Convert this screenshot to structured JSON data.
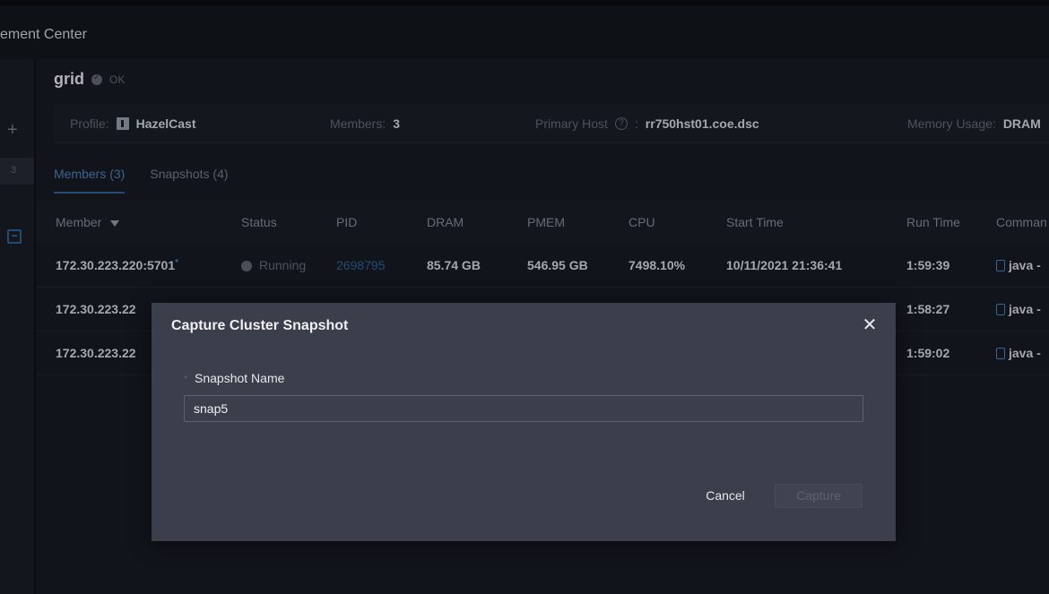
{
  "app": {
    "title": "ement Center"
  },
  "sidebar": {
    "active_item_label": "3"
  },
  "cluster": {
    "name": "grid",
    "status": "OK"
  },
  "infobar": {
    "profile_label": "Profile:",
    "profile_value": "HazelCast",
    "members_label": "Members:",
    "members_value": "3",
    "primary_host_label": "Primary Host",
    "primary_host_suffix": ":",
    "primary_host_value": "rr750hst01.coe.dsc",
    "memory_usage_label": "Memory Usage:",
    "memory_usage_value": "DRAM"
  },
  "tabs": [
    {
      "label": "Members (3)",
      "active": true
    },
    {
      "label": "Snapshots (4)",
      "active": false
    }
  ],
  "table": {
    "headers": {
      "member": "Member",
      "status": "Status",
      "pid": "PID",
      "dram": "DRAM",
      "pmem": "PMEM",
      "cpu": "CPU",
      "start_time": "Start Time",
      "run_time": "Run Time",
      "command": "Comman"
    },
    "rows": [
      {
        "member": "172.30.223.220:5701",
        "marker": "*",
        "status": "Running",
        "pid": "2698795",
        "dram": "85.74 GB",
        "pmem": "546.95 GB",
        "cpu": "7498.10%",
        "start_time": "10/11/2021 21:36:41",
        "run_time": "1:59:39",
        "command": "java -"
      },
      {
        "member": "172.30.223.22",
        "run_time": "1:58:27",
        "command": "java -"
      },
      {
        "member": "172.30.223.22",
        "run_time": "1:59:02",
        "command": "java -"
      }
    ]
  },
  "modal": {
    "title": "Capture Cluster Snapshot",
    "close": "✕",
    "field_required_mark": "*",
    "field_label": "Snapshot Name",
    "field_value": "snap5",
    "cancel_label": "Cancel",
    "capture_label": "Capture"
  }
}
